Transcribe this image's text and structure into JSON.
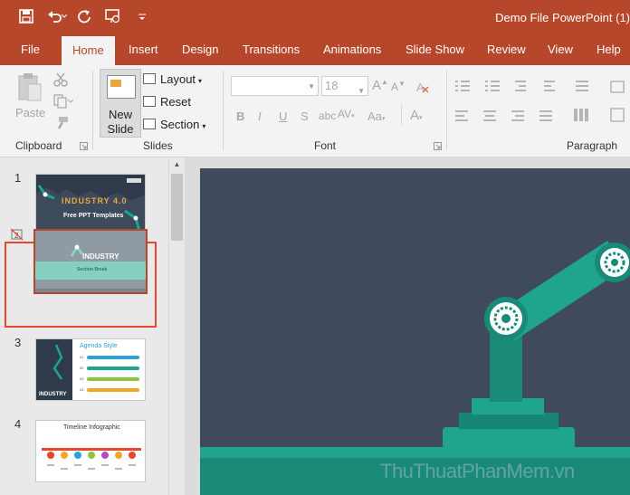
{
  "window": {
    "title": "Demo File PowerPoint (1)"
  },
  "qat": {
    "icons": [
      "save-icon",
      "undo-icon",
      "redo-icon",
      "present-icon",
      "customize-icon"
    ]
  },
  "tabs": [
    {
      "label": "File"
    },
    {
      "label": "Home"
    },
    {
      "label": "Insert"
    },
    {
      "label": "Design"
    },
    {
      "label": "Transitions"
    },
    {
      "label": "Animations"
    },
    {
      "label": "Slide Show"
    },
    {
      "label": "Review"
    },
    {
      "label": "View"
    },
    {
      "label": "Help"
    }
  ],
  "ribbon": {
    "clipboard": {
      "paste_label": "Paste",
      "group_label": "Clipboard"
    },
    "slides": {
      "new_slide_line1": "New",
      "new_slide_line2": "Slide",
      "layout_label": "Layout",
      "reset_label": "Reset",
      "section_label": "Section",
      "group_label": "Slides"
    },
    "font": {
      "font_size": "18",
      "bold": "B",
      "italic": "I",
      "underline": "U",
      "strike": "S",
      "spacing": "AV",
      "change_case": "Aa",
      "font_color": "A",
      "group_label": "Font"
    },
    "paragraph": {
      "group_label": "Paragraph"
    }
  },
  "slides": [
    {
      "number": "1",
      "title": "Free PPT Templates",
      "heading": "INDUSTRY 4.0"
    },
    {
      "number": "2",
      "title": "Section Break",
      "heading": "INDUSTRY",
      "hidden": true
    },
    {
      "number": "3",
      "title": "Agenda Style",
      "heading": "INDUSTRY"
    },
    {
      "number": "4",
      "title": "Timeline Infographic"
    }
  ],
  "watermark": "ThuThuatPhanMem.vn",
  "colors": {
    "accent": "#b7472a",
    "slide_bg": "#3f4a5c",
    "teal": "#1fa58f",
    "selection": "#e8452c"
  }
}
